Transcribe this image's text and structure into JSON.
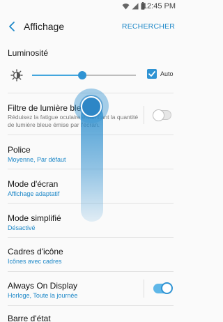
{
  "status_bar": {
    "time": "12:45 PM"
  },
  "app_bar": {
    "title": "Affichage",
    "action": "RECHERCHER"
  },
  "brightness": {
    "label": "Luminosité",
    "level_percent": 48,
    "auto_label": "Auto",
    "auto_checked": true
  },
  "blue_light": {
    "label": "Filtre de lumière bleue",
    "description": "Réduisez la fatigue oculaire en limitant la quantité de lumière bleue émise par l'écran.",
    "enabled": false
  },
  "settings": [
    {
      "label": "Police",
      "value": "Moyenne, Par défaut"
    },
    {
      "label": "Mode d'écran",
      "value": "Affichage adaptatif"
    },
    {
      "label": "Mode simplifié",
      "value": "Désactivé"
    },
    {
      "label": "Cadres d'icône",
      "value": "Icônes avec cadres"
    },
    {
      "label": "Always On Display",
      "value": "Horloge, Toute la journée",
      "enabled": true
    },
    {
      "label": "Barre d'état"
    }
  ],
  "colors": {
    "accent": "#2f93d3",
    "link": "#1e88c8"
  }
}
